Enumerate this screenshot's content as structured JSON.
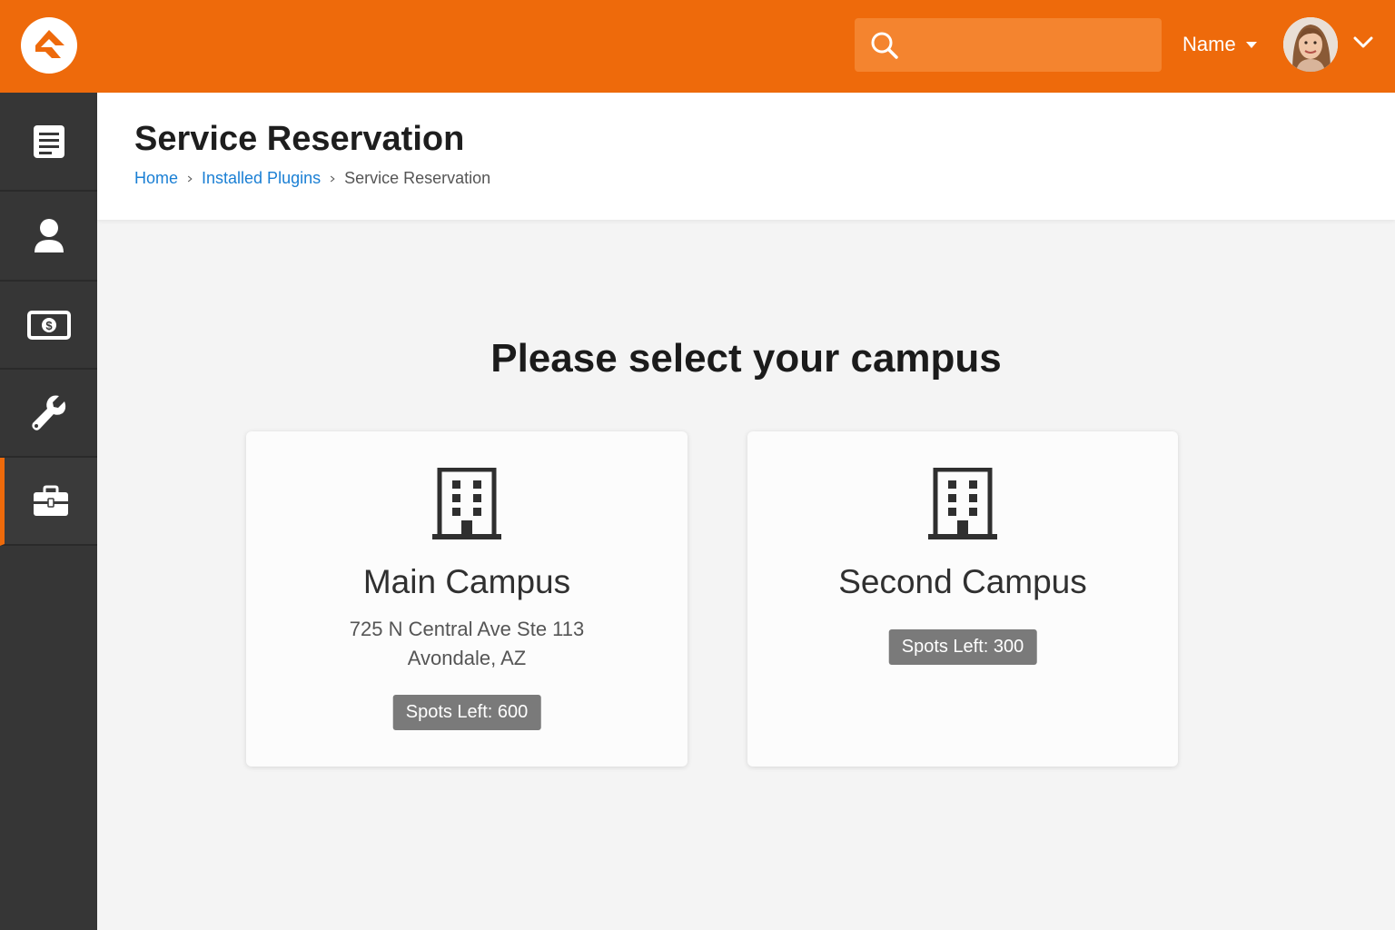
{
  "colors": {
    "brand": "#ee6a0b",
    "sidebar": "#363636",
    "link": "#1a7fd4",
    "badge": "#7a7a7a"
  },
  "header": {
    "search_placeholder": "",
    "user_name": "Name"
  },
  "sidebar": {
    "items": [
      {
        "icon": "document-list-icon"
      },
      {
        "icon": "person-icon"
      },
      {
        "icon": "money-icon"
      },
      {
        "icon": "wrench-icon"
      },
      {
        "icon": "briefcase-icon",
        "active": true
      }
    ]
  },
  "page": {
    "title": "Service Reservation",
    "breadcrumb": [
      "Home",
      "Installed Plugins",
      "Service Reservation"
    ]
  },
  "main": {
    "prompt": "Please select your campus",
    "campuses": [
      {
        "name": "Main Campus",
        "address_line1": "725 N Central Ave Ste 113",
        "address_line2": "Avondale, AZ",
        "spots": "Spots Left: 600"
      },
      {
        "name": "Second Campus",
        "spots": "Spots Left: 300"
      }
    ]
  }
}
